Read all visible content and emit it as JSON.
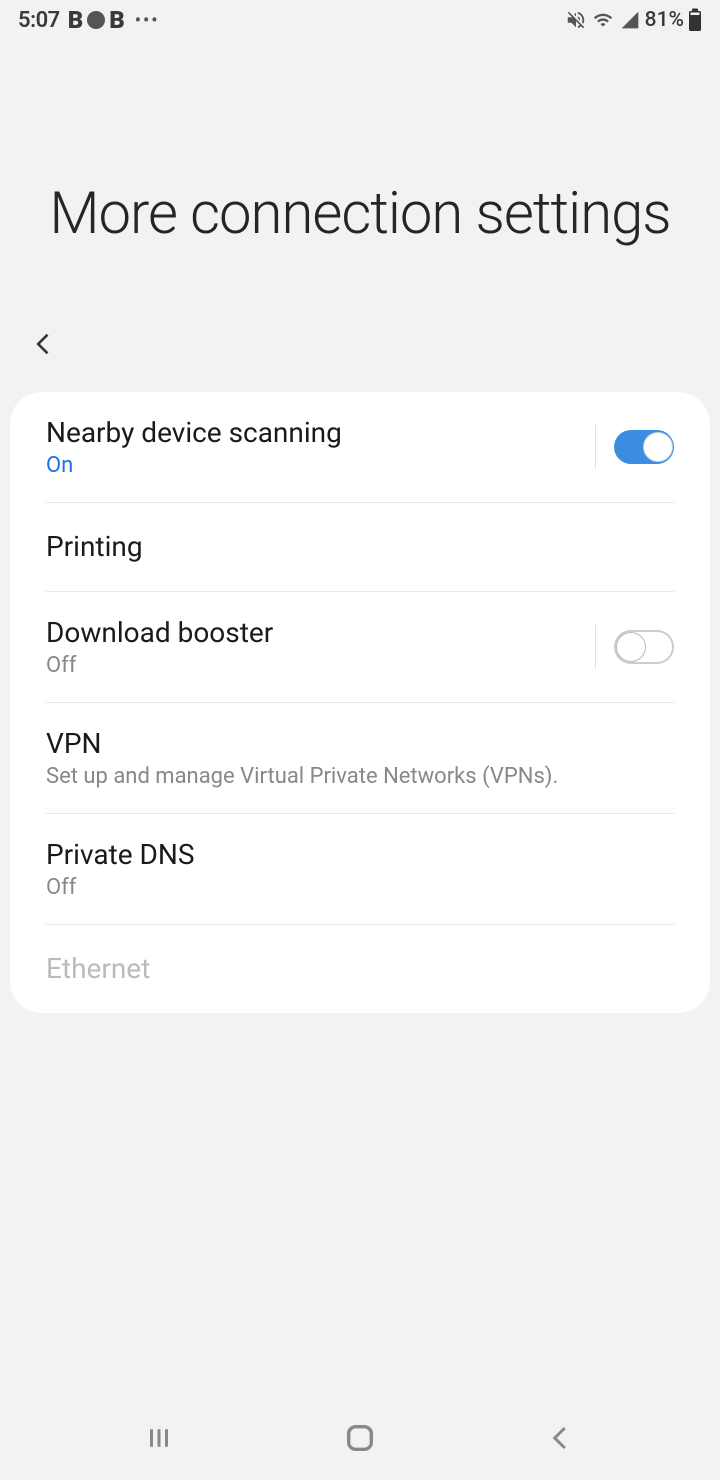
{
  "status": {
    "time": "5:07",
    "battery": "81%"
  },
  "header": {
    "title": "More connection settings"
  },
  "settings": {
    "nearby": {
      "title": "Nearby device scanning",
      "status": "On"
    },
    "printing": {
      "title": "Printing"
    },
    "download": {
      "title": "Download booster",
      "status": "Off"
    },
    "vpn": {
      "title": "VPN",
      "sub": "Set up and manage Virtual Private Networks (VPNs)."
    },
    "dns": {
      "title": "Private DNS",
      "status": "Off"
    },
    "ethernet": {
      "title": "Ethernet"
    }
  }
}
